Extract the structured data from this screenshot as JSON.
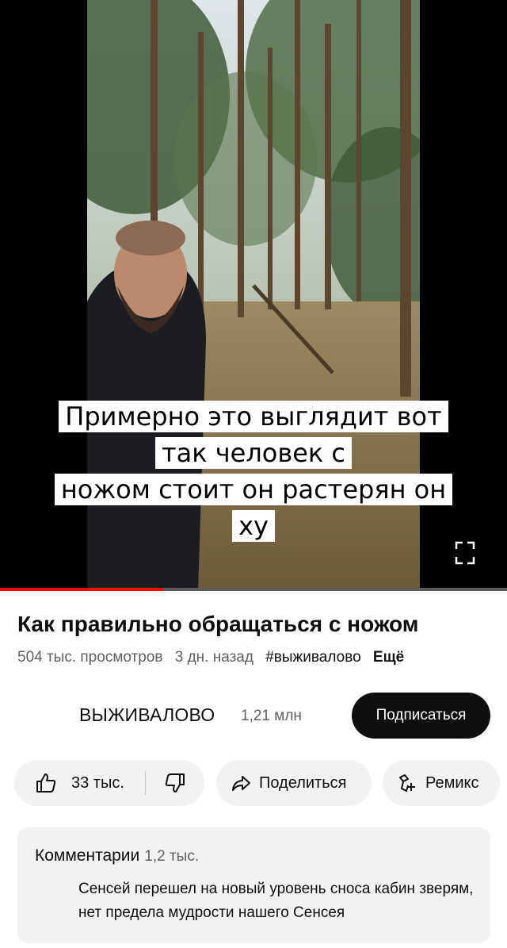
{
  "player": {
    "captions": [
      "Примерно это выглядит вот",
      "так человек с",
      "ножом стоит он растерян он",
      "ху"
    ],
    "progress_fraction": 0.32
  },
  "video": {
    "title": "Как правильно обращаться с ножом",
    "views": "504 тыс. просмотров",
    "uploaded": "3 дн. назад",
    "hashtag": "#выживалово",
    "more_label": "Ещё"
  },
  "channel": {
    "name": "ВЫЖИВАЛОВО",
    "subscribers": "1,21 млн",
    "subscribe_label": "Подписаться"
  },
  "actions": {
    "likes": "33 тыс.",
    "share_label": "Поделиться",
    "remix_label": "Ремикс"
  },
  "comments": {
    "title": "Комментарии",
    "count": "1,2 тыс.",
    "top_comment": "Сенсей перешел на новый уровень сноса кабин зверям, нет предела мудрости нашего Сенсея"
  },
  "colors": {
    "accent": "#ff0000",
    "button_dark": "#0f0f0f",
    "surface": "#f2f2f2",
    "secondary_text": "#606060"
  },
  "icons": [
    "fullscreen-icon",
    "thumbs-up-icon",
    "thumbs-down-icon",
    "share-icon",
    "remix-icon"
  ]
}
